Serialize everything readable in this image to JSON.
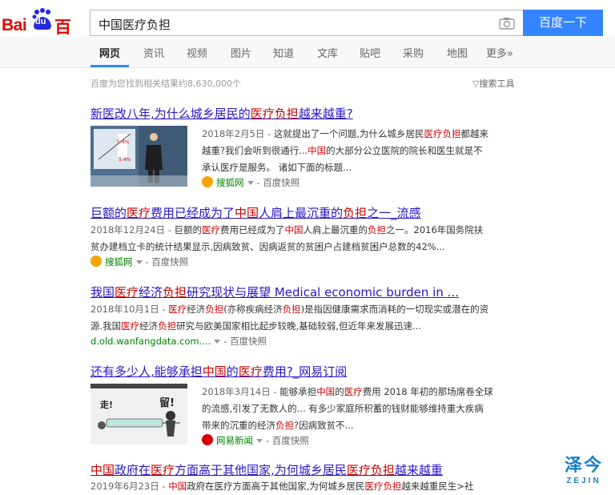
{
  "logo": {
    "bai": "Bai",
    "du": "du",
    "chinese": "百度"
  },
  "search": {
    "query": "中国医疗负担",
    "button": "百度一下"
  },
  "tabs": [
    "网页",
    "资讯",
    "视频",
    "图片",
    "知道",
    "文库",
    "贴吧",
    "采购",
    "地图",
    "更多»"
  ],
  "active_tab": "网页",
  "result_count": "百度为您找到相关结果约8,630,000个",
  "search_tools": "搜索工具",
  "results": [
    {
      "title_parts": [
        "新医改八年,为什么城乡居民的",
        "医疗负担",
        "越来越重?"
      ],
      "date": "2018年2月5日 - ",
      "snippet_l1": [
        "这就提出了一个问题,为什么城乡居民",
        "医疗负担",
        "都越来"
      ],
      "snippet_l2": [
        "越重?我们会听到很通行...",
        "中国",
        "的大部分公立医院的院长和医生就是不"
      ],
      "snippet_l3": "承认医疗是服务。 诸如下面的标题...",
      "source": "搜狐网",
      "kuaizhao": "- 百度快照",
      "thumb": {
        "pct1": "5.4%",
        "pct2": "5.4%"
      }
    },
    {
      "title_parts": [
        "巨额的",
        "医疗",
        "费用已经成为了",
        "中国",
        "人肩上最沉重的",
        "负担",
        "之一_流感"
      ],
      "date": "2018年12月24日 - ",
      "snippet_l1": [
        "巨额的",
        "医疗",
        "费用已经成为了",
        "中国",
        "人肩上最沉重的",
        "负担",
        "之一。2016年国务院扶"
      ],
      "snippet_l2": "贫办建档立卡的统计结果显示,因病致贫、因病返贫的贫困户占建档贫困户总数的42%...",
      "source": "搜狐网",
      "kuaizhao": "- 百度快照"
    },
    {
      "title_parts": [
        "我国",
        "医疗",
        "经济",
        "负担",
        "研究现状与展望 Medical economic burden in ..."
      ],
      "date": "2018年10月1日 - ",
      "snippet_l1": [
        "医疗",
        "经济",
        "负担",
        "(亦称疾病经济",
        "负担",
        ")是指因健康需求而消耗的一切现实或潜在的资"
      ],
      "snippet_l2": [
        "源.我国",
        "医疗",
        "经济",
        "负担",
        "研究与欧美国家相比起步较晚,基础较弱,但近年来发展迅速..."
      ],
      "source": "d.old.wanfangdata.com....",
      "kuaizhao": "- 百度快照"
    },
    {
      "title_parts": [
        "还有多少人,能够承担",
        "中国",
        "的",
        "医疗",
        "费用?_网易订阅"
      ],
      "date": "2018年3月14日 - ",
      "snippet_l1": [
        "能够承担",
        "中国",
        "的",
        "医疗",
        "费用 2018 年初的那场席卷全球"
      ],
      "snippet_l2": "的流感,引发了无数人的... 有多少家庭所积蓄的钱财能够维持重大疾病",
      "snippet_l3": [
        "带来的沉重的经济",
        "负担",
        "?因病致贫不..."
      ],
      "source": "网易新闻",
      "kuaizhao": "- 百度快照",
      "thumb": {
        "t1": "走!",
        "t2": "留!"
      }
    },
    {
      "title_parts": [
        "中国",
        "政府在",
        "医疗",
        "方面高于其他国家,为何城乡居民",
        "医疗负担",
        "越来越重"
      ],
      "date": "2019年6月23日 - ",
      "snippet_l1": [
        "中国",
        "政府在医疗方面高于其他国家,为何城乡居民",
        "医疗负担",
        "越来越重民生>社"
      ]
    }
  ],
  "watermark": {
    "cn": "泽今",
    "en": "ZEJIN"
  },
  "colors": {
    "link": "#2a16c9",
    "highlight": "#c00",
    "green": "#008000",
    "button": "#3385ff",
    "logo_red": "#e10601"
  }
}
